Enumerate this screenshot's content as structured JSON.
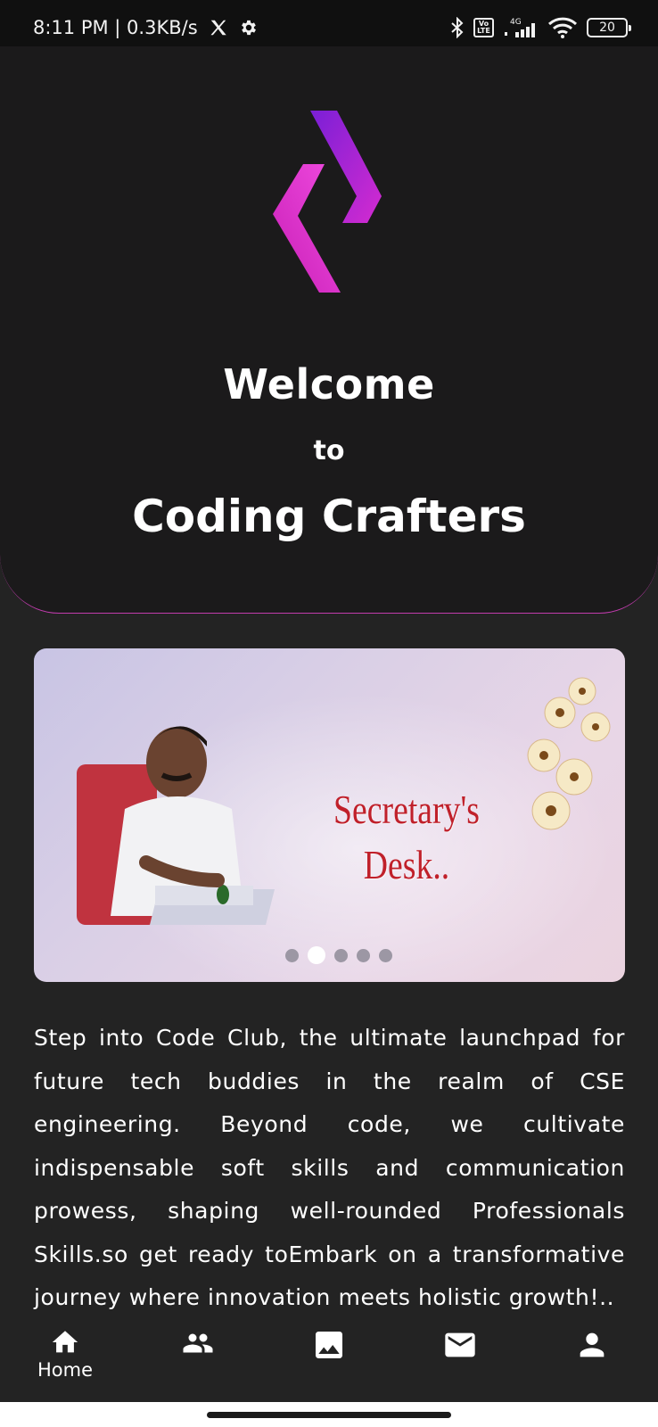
{
  "status_bar": {
    "time_speed": "8:11 PM | 0.3KB/s",
    "x_icon": "x-logo-icon",
    "settings_icon": "gear-icon",
    "volte": "Vo LTE",
    "network": "4G",
    "battery": "20"
  },
  "hero": {
    "logo_icon": "coding-crafters-logo",
    "welcome": "Welcome",
    "to": "to",
    "brand": "Coding Crafters",
    "accent_color": "#c23cae"
  },
  "carousel": {
    "banner_title_line1": "Secretary's",
    "banner_title_line2": "Desk..",
    "slide_count": 5,
    "active_slide": 2
  },
  "description": "Step into Code Club, the ultimate launchpad for future tech buddies in the realm of CSE engineering. Beyond code, we cultivate indispensable soft skills and communication prowess, shaping well-rounded Professionals Skills.so get ready toEmbark on a transformative journey where innovation meets holistic growth!..",
  "bottom_nav": {
    "items": [
      {
        "icon": "home-icon",
        "label": "Home"
      },
      {
        "icon": "people-icon",
        "label": ""
      },
      {
        "icon": "image-icon",
        "label": ""
      },
      {
        "icon": "mail-icon",
        "label": ""
      },
      {
        "icon": "person-icon",
        "label": ""
      }
    ]
  }
}
